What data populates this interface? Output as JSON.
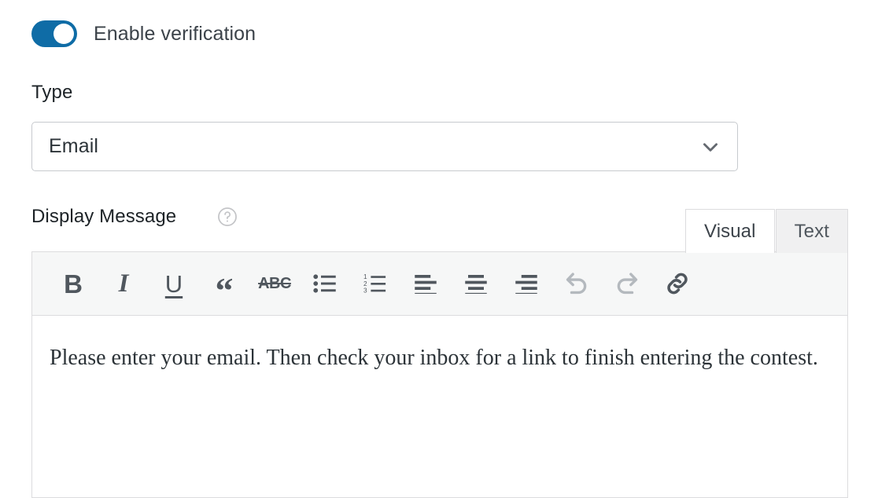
{
  "verification": {
    "toggle_label": "Enable verification",
    "toggle_state": "on",
    "toggle_color": "#0f6ca6"
  },
  "type_field": {
    "label": "Type",
    "value": "Email",
    "chevron_icon": "chevron-down-icon"
  },
  "display_message": {
    "label": "Display Message",
    "help_icon": "help-circle-icon",
    "tabs": [
      {
        "label": "Visual",
        "active": true
      },
      {
        "label": "Text",
        "active": false
      }
    ],
    "toolbar": [
      {
        "name": "bold",
        "glyph": "B",
        "label": "Bold",
        "disabled": false
      },
      {
        "name": "italic",
        "glyph": "I",
        "label": "Italic",
        "disabled": false
      },
      {
        "name": "underline",
        "glyph": "U",
        "label": "Underline",
        "disabled": false
      },
      {
        "name": "blockquote",
        "glyph": "“",
        "label": "Blockquote",
        "disabled": false
      },
      {
        "name": "strikethrough",
        "glyph": "ABC",
        "label": "Strikethrough",
        "disabled": false
      },
      {
        "name": "bulleted-list",
        "glyph": "",
        "label": "Bulleted list",
        "disabled": false
      },
      {
        "name": "numbered-list",
        "glyph": "",
        "label": "Numbered list",
        "disabled": false
      },
      {
        "name": "align-left",
        "glyph": "",
        "label": "Align left",
        "disabled": false
      },
      {
        "name": "align-center",
        "glyph": "",
        "label": "Align center",
        "disabled": false
      },
      {
        "name": "align-right",
        "glyph": "",
        "label": "Align right",
        "disabled": false
      },
      {
        "name": "undo",
        "glyph": "",
        "label": "Undo",
        "disabled": true
      },
      {
        "name": "redo",
        "glyph": "",
        "label": "Redo",
        "disabled": true
      },
      {
        "name": "link",
        "glyph": "",
        "label": "Insert link",
        "disabled": false
      }
    ],
    "content": "Please enter your email. Then check your inbox for a link to finish entering the contest."
  }
}
